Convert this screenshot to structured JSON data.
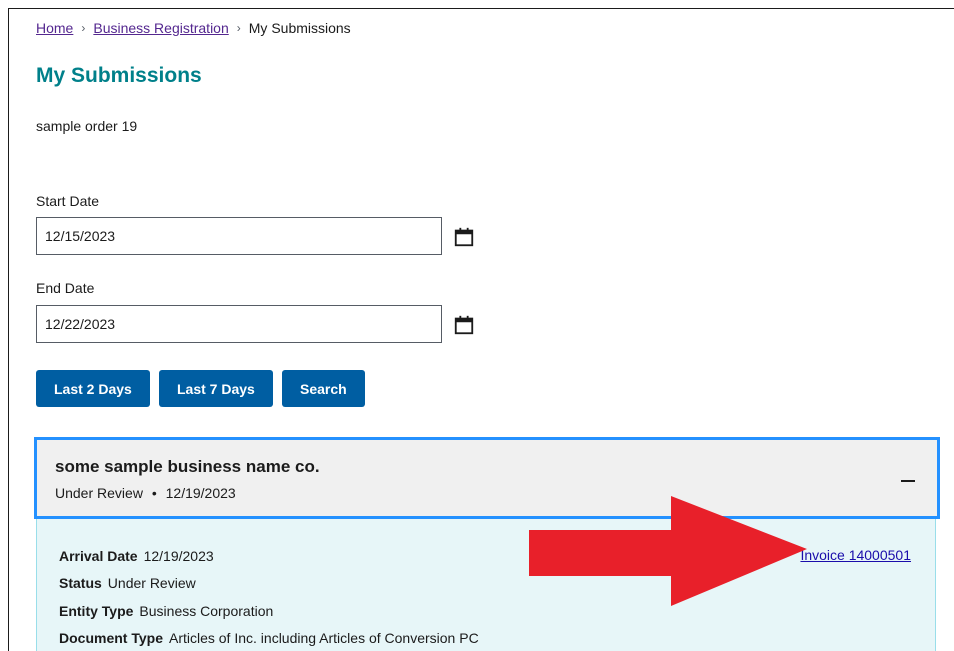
{
  "breadcrumb": {
    "home": "Home",
    "business_registration": "Business Registration",
    "current": "My Submissions",
    "separator": "›"
  },
  "page": {
    "title": "My Submissions",
    "subtext": "sample order 19"
  },
  "filters": {
    "start_label": "Start Date",
    "start_value": "12/15/2023",
    "end_label": "End Date",
    "end_value": "12/22/2023"
  },
  "buttons": {
    "last2": "Last 2 Days",
    "last7": "Last 7 Days",
    "search": "Search"
  },
  "submission": {
    "name": "some sample business name co.",
    "status": "Under Review",
    "bullet": "•",
    "date": "12/19/2023",
    "details": {
      "arrival_label": "Arrival Date",
      "arrival_value": "12/19/2023",
      "status_label": "Status",
      "status_value": "Under Review",
      "entity_label": "Entity Type",
      "entity_value": "Business Corporation",
      "doctype_label": "Document Type",
      "doctype_value": "Articles of Inc. including Articles of Conversion PC"
    },
    "invoice_link": "Invoice 14000501"
  },
  "icons": {
    "calendar": "calendar-icon",
    "collapse": "minus-icon",
    "annotation": "red-arrow"
  },
  "colors": {
    "title": "#00808a",
    "button": "#005ea2",
    "link_visited": "#54278f",
    "accordion_border": "#2491ff",
    "arrow": "#e8202a"
  }
}
